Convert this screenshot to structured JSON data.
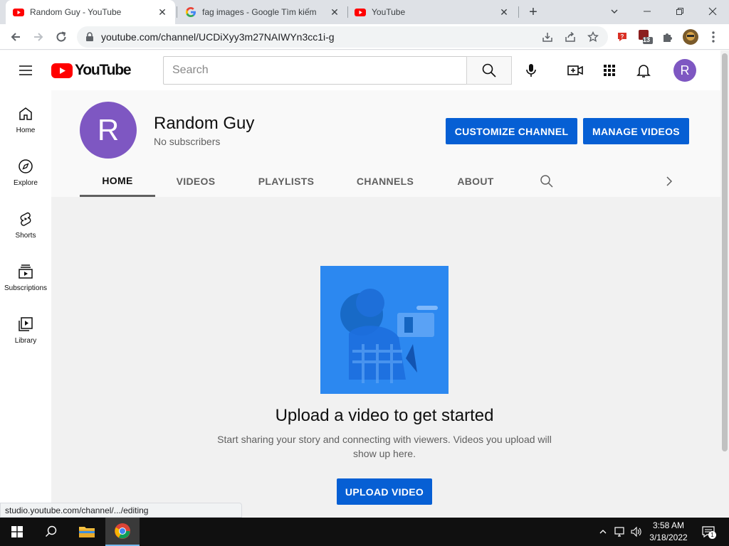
{
  "browser": {
    "tabs": [
      {
        "title": "Random Guy - YouTube",
        "active": true,
        "favicon": "youtube-icon"
      },
      {
        "title": "fag images - Google Tìm kiếm",
        "active": false,
        "favicon": "google-icon"
      },
      {
        "title": "YouTube",
        "active": false,
        "favicon": "youtube-icon"
      }
    ],
    "url": "youtube.com/channel/UCDiXyy3m27NAIWYn3cc1i-g",
    "extension_badge": "13",
    "status_url": "studio.youtube.com/channel/.../editing"
  },
  "youtube": {
    "logo_text": "YouTube",
    "search_placeholder": "Search",
    "user_initial": "R",
    "guide": [
      {
        "label": "Home",
        "icon": "home-icon"
      },
      {
        "label": "Explore",
        "icon": "compass-icon"
      },
      {
        "label": "Shorts",
        "icon": "shorts-icon"
      },
      {
        "label": "Subscriptions",
        "icon": "subscriptions-icon"
      },
      {
        "label": "Library",
        "icon": "library-icon"
      }
    ]
  },
  "channel": {
    "initial": "R",
    "name": "Random Guy",
    "subscribers": "No subscribers",
    "customize_label": "CUSTOMIZE CHANNEL",
    "manage_label": "MANAGE VIDEOS",
    "tabs": [
      "HOME",
      "VIDEOS",
      "PLAYLISTS",
      "CHANNELS",
      "ABOUT"
    ],
    "active_tab": "HOME"
  },
  "empty_state": {
    "title": "Upload a video to get started",
    "text": "Start sharing your story and connecting with viewers. Videos you upload will show up here.",
    "button_label": "UPLOAD VIDEO"
  },
  "taskbar": {
    "time": "3:58 AM",
    "date": "3/18/2022",
    "notification_count": "1"
  },
  "colors": {
    "accent_blue": "#065fd4",
    "avatar_purple": "#7e57c2",
    "youtube_red": "#ff0000"
  }
}
